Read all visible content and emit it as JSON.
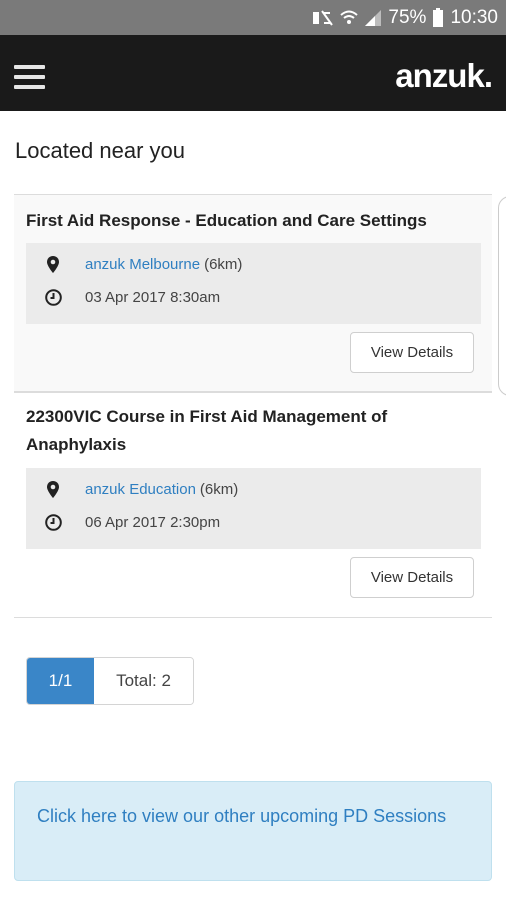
{
  "status_bar": {
    "battery": "75%",
    "time": "10:30",
    "icons": [
      "mute-icon",
      "wifi-icon",
      "signal-icon",
      "battery-icon"
    ]
  },
  "navbar": {
    "menu_icon": "hamburger-menu-icon",
    "logo": "anzuk."
  },
  "main": {
    "heading": "Located near you",
    "sessions": [
      {
        "title": "First Aid Response - Education and Care Settings",
        "location_link": "anzuk Melbourne",
        "distance": "(6km)",
        "datetime": "03 Apr 2017 8:30am",
        "button": "View Details"
      },
      {
        "title": "22300VIC Course in First Aid Management of Anaphylaxis",
        "location_link": "anzuk Education",
        "distance": "(6km)",
        "datetime": "06 Apr 2017 2:30pm",
        "button": "View Details"
      }
    ],
    "pagination": {
      "page": "1/1",
      "total": "Total: 2"
    },
    "banner": "Click here to view our other upcoming PD Sessions"
  },
  "colors": {
    "navbar_bg": "#1a1a1a",
    "link": "#2f7fc1",
    "pager_active": "#3a86c8",
    "banner_bg": "#d9edf7"
  }
}
